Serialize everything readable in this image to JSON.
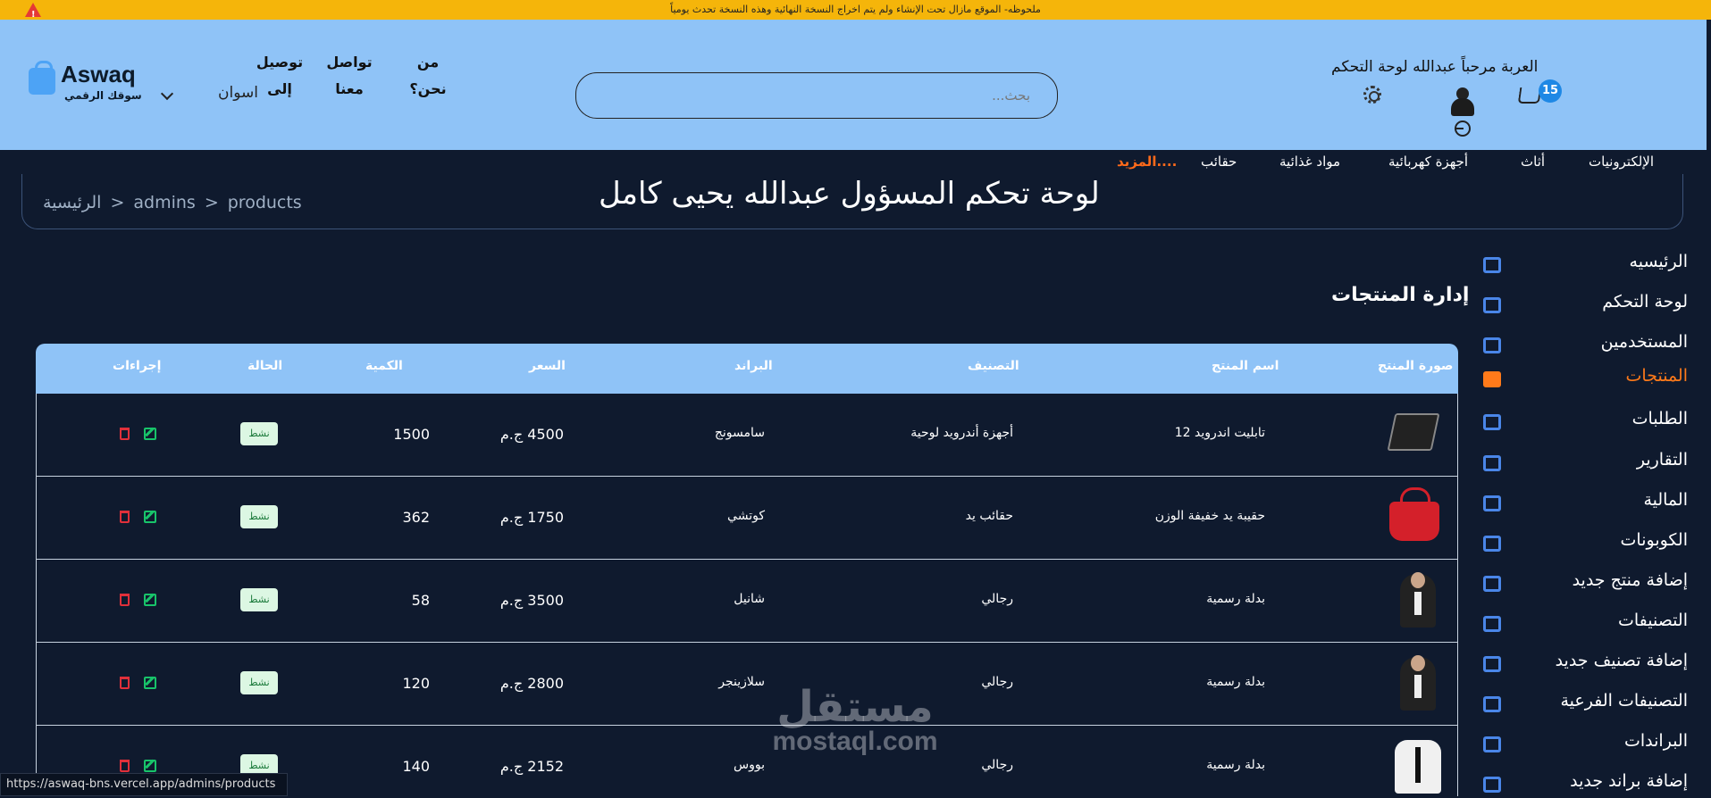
{
  "notice": {
    "text": "ملحوظه- الموقع مازال تحت الإنشاء ولم يتم اخراج النسخة النهائية وهذه النسخة تحدث يومياً"
  },
  "header": {
    "logo": {
      "brand": "Aswaq",
      "tagline": "سوقك الرقمي"
    },
    "city": "اسوان",
    "nav": [
      {
        "label": "توصيل إلى"
      },
      {
        "label": "تواصل معنا"
      },
      {
        "label": "من نحن؟"
      }
    ],
    "search": {
      "placeholder": "بحث...",
      "value": ""
    },
    "welcome": "العربة مرحباً عبدالله لوحة التحكم",
    "cart_count": "15"
  },
  "categories": [
    {
      "label": "الإلكترونيات"
    },
    {
      "label": "أثاث"
    },
    {
      "label": "أجهزة كهربائية"
    },
    {
      "label": "مواد غذائية"
    },
    {
      "label": "حقائب"
    },
    {
      "label": "المزيد...."
    }
  ],
  "page": {
    "title": "لوحة تحكم المسؤول عبدالله يحيى كامل",
    "breadcrumb": [
      "الرئيسية",
      "admins",
      "products"
    ]
  },
  "sidebar": {
    "items": [
      {
        "label": "الرئيسيه",
        "icon": "chart-line-icon"
      },
      {
        "label": "لوحة التحكم",
        "icon": "dashboard-icon"
      },
      {
        "label": "المستخدمين",
        "icon": "users-icon"
      },
      {
        "label": "المنتجات",
        "icon": "archive-box-icon",
        "active": true
      },
      {
        "label": "الطلبات",
        "icon": "truck-icon"
      },
      {
        "label": "التقارير",
        "icon": "bar-chart-icon"
      },
      {
        "label": "المالية",
        "icon": "money-icon"
      },
      {
        "label": "الكوبونات",
        "icon": "ticket-icon"
      },
      {
        "label": "إضافة منتج جديد",
        "icon": "plus-square-icon"
      },
      {
        "label": "التصنيفات",
        "icon": "grid-icon"
      },
      {
        "label": "إضافة تصنيف جديد",
        "icon": "grid-plus-icon"
      },
      {
        "label": "التصنيفات الفرعية",
        "icon": "tree-icon"
      },
      {
        "label": "البراندات",
        "icon": "brand-b-icon"
      },
      {
        "label": "إضافة براند جديد",
        "icon": "monitor-plus-icon"
      }
    ]
  },
  "section_title": "إدارة المنتجات",
  "table": {
    "headers": [
      "صورة المنتج",
      "اسم المنتج",
      "التصنيف",
      "البراند",
      "السعر",
      "الكمية",
      "الحالة",
      "إجراءات"
    ],
    "rows": [
      {
        "image": "tablet-image",
        "name": "تابليت اندرويد 12",
        "category": "أجهزة أندرويد لوحية",
        "brand": "سامسونج",
        "price": "4500 ج.م",
        "qty": "1500",
        "status": "نشط"
      },
      {
        "image": "handbag-image",
        "name": "حقيبة يد خفيفة الوزن",
        "category": "حقائب يد",
        "brand": "كوتشي",
        "price": "1750 ج.م",
        "qty": "362",
        "status": "نشط"
      },
      {
        "image": "suit-image",
        "name": "بدلة رسمية",
        "category": "رجالي",
        "brand": "شانيل",
        "price": "3500 ج.م",
        "qty": "58",
        "status": "نشط"
      },
      {
        "image": "tuxedo-image",
        "name": "بدلة رسمية",
        "category": "رجالي",
        "brand": "سلازينجر",
        "price": "2800 ج.م",
        "qty": "120",
        "status": "نشط"
      },
      {
        "image": "shirt-image",
        "name": "بدلة رسمية",
        "category": "رجالي",
        "brand": "بووس",
        "price": "2152 ج.م",
        "qty": "140",
        "status": "نشط"
      }
    ]
  },
  "statusbar": {
    "url": "https://aswaq-bns.vercel.app/admins/products"
  },
  "watermark": {
    "ar": "مستقل",
    "en": "mostaql.com"
  },
  "colors": {
    "accent": "#ff7a1a",
    "header_bg": "#8fc3f7",
    "page_bg": "#0f1a2e",
    "notice_bg": "#f5b50a",
    "status_bg": "#dcf7e3"
  }
}
